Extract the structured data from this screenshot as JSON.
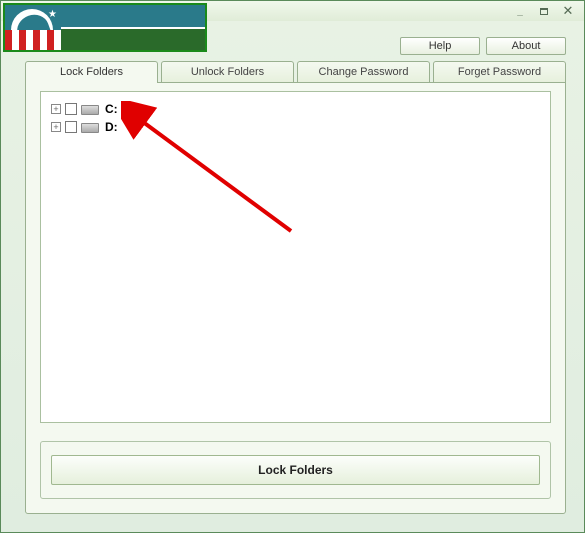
{
  "toolbar": {
    "help_label": "Help",
    "about_label": "About"
  },
  "tabs": [
    {
      "label": "Lock Folders",
      "active": true
    },
    {
      "label": "Unlock Folders",
      "active": false
    },
    {
      "label": "Change Password",
      "active": false
    },
    {
      "label": "Forget Password",
      "active": false
    }
  ],
  "tree": {
    "items": [
      {
        "label": "C:"
      },
      {
        "label": "D:"
      }
    ]
  },
  "action": {
    "lock_button_label": "Lock Folders"
  }
}
